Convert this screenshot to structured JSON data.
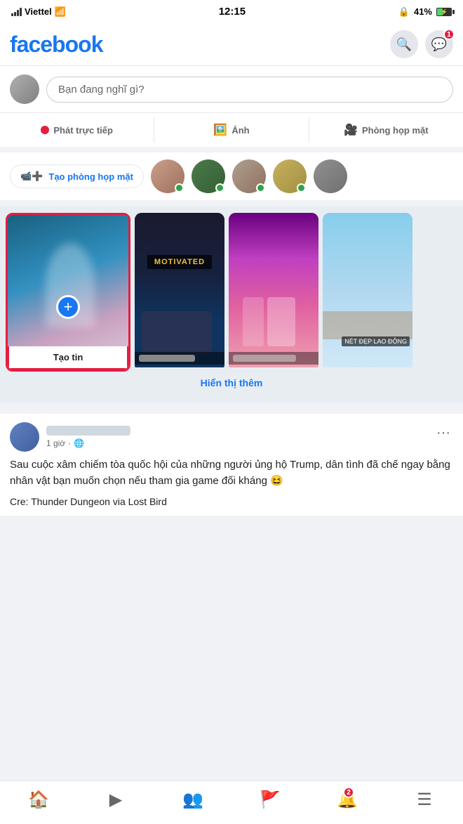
{
  "statusBar": {
    "carrier": "Viettel",
    "time": "12:15",
    "battery": "41%"
  },
  "header": {
    "logo": "facebook",
    "searchLabel": "search",
    "messengerLabel": "messenger",
    "messengerBadge": "1"
  },
  "postCreator": {
    "placeholder": "Bạn đang nghĩ gì?"
  },
  "postActions": {
    "live": "Phát trực tiếp",
    "photo": "Ảnh",
    "room": "Phòng họp mặt"
  },
  "stories": {
    "createRoomLabel": "Tạo phòng họp mặt",
    "createStoryLabel": "Tạo tin",
    "showMoreLabel": "Hiển thị thêm",
    "motivatedText": "MOTIVATED",
    "netDepText": "NÉT ĐẸP LAO ĐỘNG"
  },
  "post": {
    "timeAgo": "1 giờ",
    "privacy": "🌐",
    "text": "Sau cuộc xâm chiếm tòa quốc hội của những người ủng hộ Trump, dân tình đã chế ngay bằng nhân vật bạn muốn chọn nếu tham gia game đối kháng 😆",
    "credit": "Cre: Thunder Dungeon via Lost Bird"
  },
  "bottomNav": {
    "home": "home",
    "video": "video",
    "friends": "friends",
    "flag": "flag",
    "bell": "bell",
    "menu": "menu",
    "bellBadge": "2"
  }
}
